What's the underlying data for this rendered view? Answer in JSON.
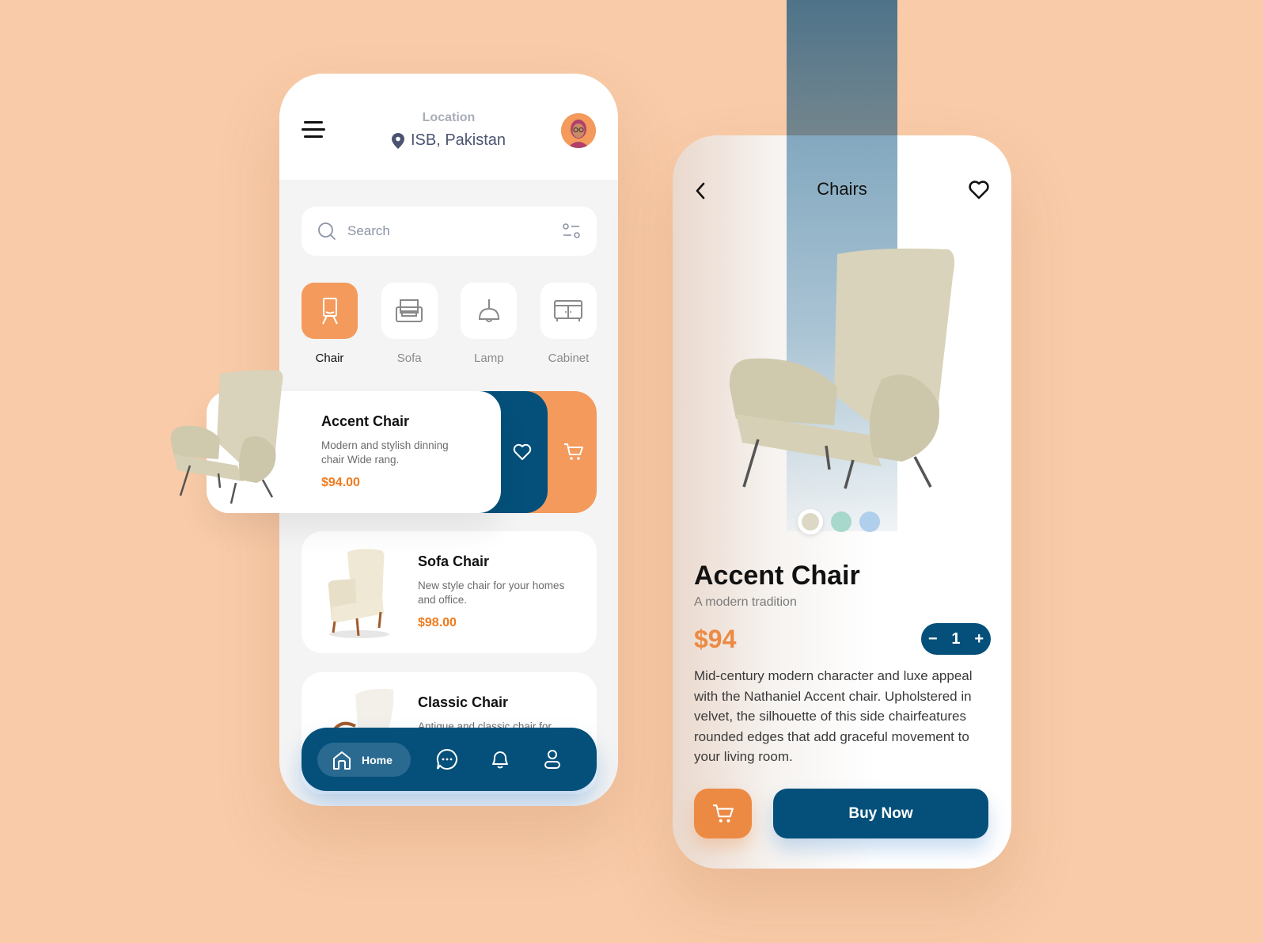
{
  "header": {
    "location_label": "Location",
    "location_value": "ISB, Pakistan"
  },
  "search": {
    "placeholder": "Search"
  },
  "categories": [
    {
      "label": "Chair",
      "icon": "chair-icon",
      "active": true
    },
    {
      "label": "Sofa",
      "icon": "sofa-icon",
      "active": false
    },
    {
      "label": "Lamp",
      "icon": "lamp-icon",
      "active": false
    },
    {
      "label": "Cabinet",
      "icon": "cabinet-icon",
      "active": false
    }
  ],
  "products": [
    {
      "name": "Accent Chair",
      "desc": "Modern and stylish dinning chair Wide rang.",
      "price": "$94.00"
    },
    {
      "name": "Sofa Chair",
      "desc": "New style chair for your homes and office.",
      "price": "$98.00"
    },
    {
      "name": "Classic Chair",
      "desc": "Antique and classic chair for",
      "price": ""
    }
  ],
  "nav": {
    "home_label": "Home",
    "items": [
      "home-icon",
      "chat-icon",
      "bell-icon",
      "profile-icon"
    ]
  },
  "detail": {
    "title": "Chairs",
    "product_name": "Accent Chair",
    "subtitle": "A modern tradition",
    "price": "$94",
    "quantity": "1",
    "minus": "−",
    "plus": "+",
    "description": "Mid-century modern character and luxe appeal with the Nathaniel Accent chair. Upholstered in velvet, the silhouette of this side chairfeatures rounded edges that add graceful movement to your living room.",
    "buy_label": "Buy Now",
    "color_options": [
      "#dcd8c4",
      "#a8d8cc",
      "#b0cfec"
    ],
    "selected_color": 0
  },
  "colors": {
    "brand_blue": "#04507a",
    "accent_orange": "#f39a5c",
    "price_orange": "#f07a1c",
    "background": "#f9cba8"
  }
}
